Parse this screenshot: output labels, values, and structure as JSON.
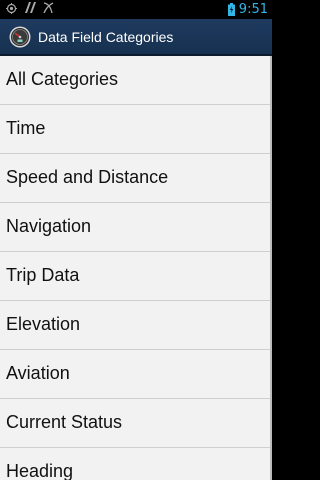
{
  "status_bar": {
    "time": "9:51",
    "icons": [
      "location-icon",
      "signal-icon",
      "missed-call-icon",
      "battery-icon"
    ],
    "time_color": "#33b5e5"
  },
  "action_bar": {
    "title": "Data Field Categories",
    "icon": "speedometer-app-icon"
  },
  "categories": [
    {
      "label": "All Categories"
    },
    {
      "label": "Time"
    },
    {
      "label": "Speed and Distance"
    },
    {
      "label": "Navigation"
    },
    {
      "label": "Trip Data"
    },
    {
      "label": "Elevation"
    },
    {
      "label": "Aviation"
    },
    {
      "label": "Current Status"
    },
    {
      "label": "Heading"
    }
  ]
}
